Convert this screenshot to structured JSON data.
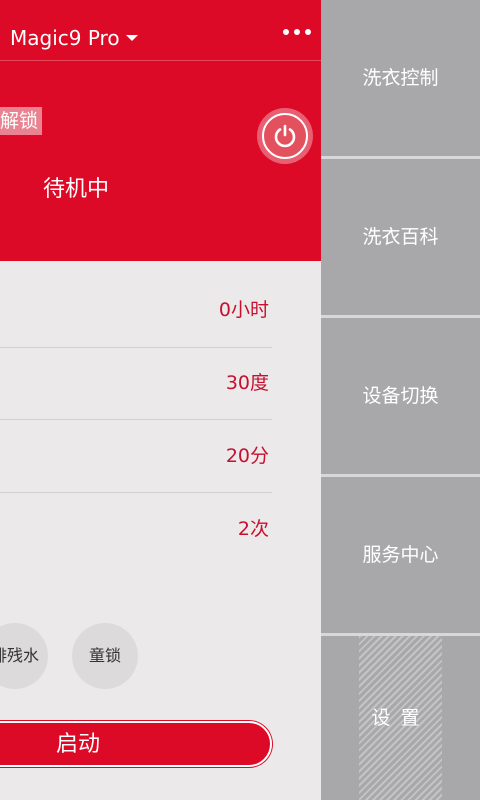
{
  "header": {
    "device_name": "Magic9 Pro",
    "more_icon": "more-dots-icon"
  },
  "status": {
    "unlock_label": "解锁",
    "power_icon": "power-icon",
    "state_text": "待机中"
  },
  "params": [
    {
      "value": "0小时"
    },
    {
      "value": "30度"
    },
    {
      "value": "20分"
    },
    {
      "value": "2次"
    }
  ],
  "options": {
    "drain_label": "排残水",
    "child_lock_label": "童锁"
  },
  "start": {
    "label": "启动"
  },
  "drawer": {
    "items": [
      {
        "label": "洗衣控制"
      },
      {
        "label": "洗衣百科"
      },
      {
        "label": "设备切换"
      },
      {
        "label": "服务中心"
      },
      {
        "label": "设置"
      }
    ]
  },
  "colors": {
    "accent": "#dc0a26",
    "value_text": "#c8102e",
    "drawer_bg": "#a8a8aa"
  }
}
